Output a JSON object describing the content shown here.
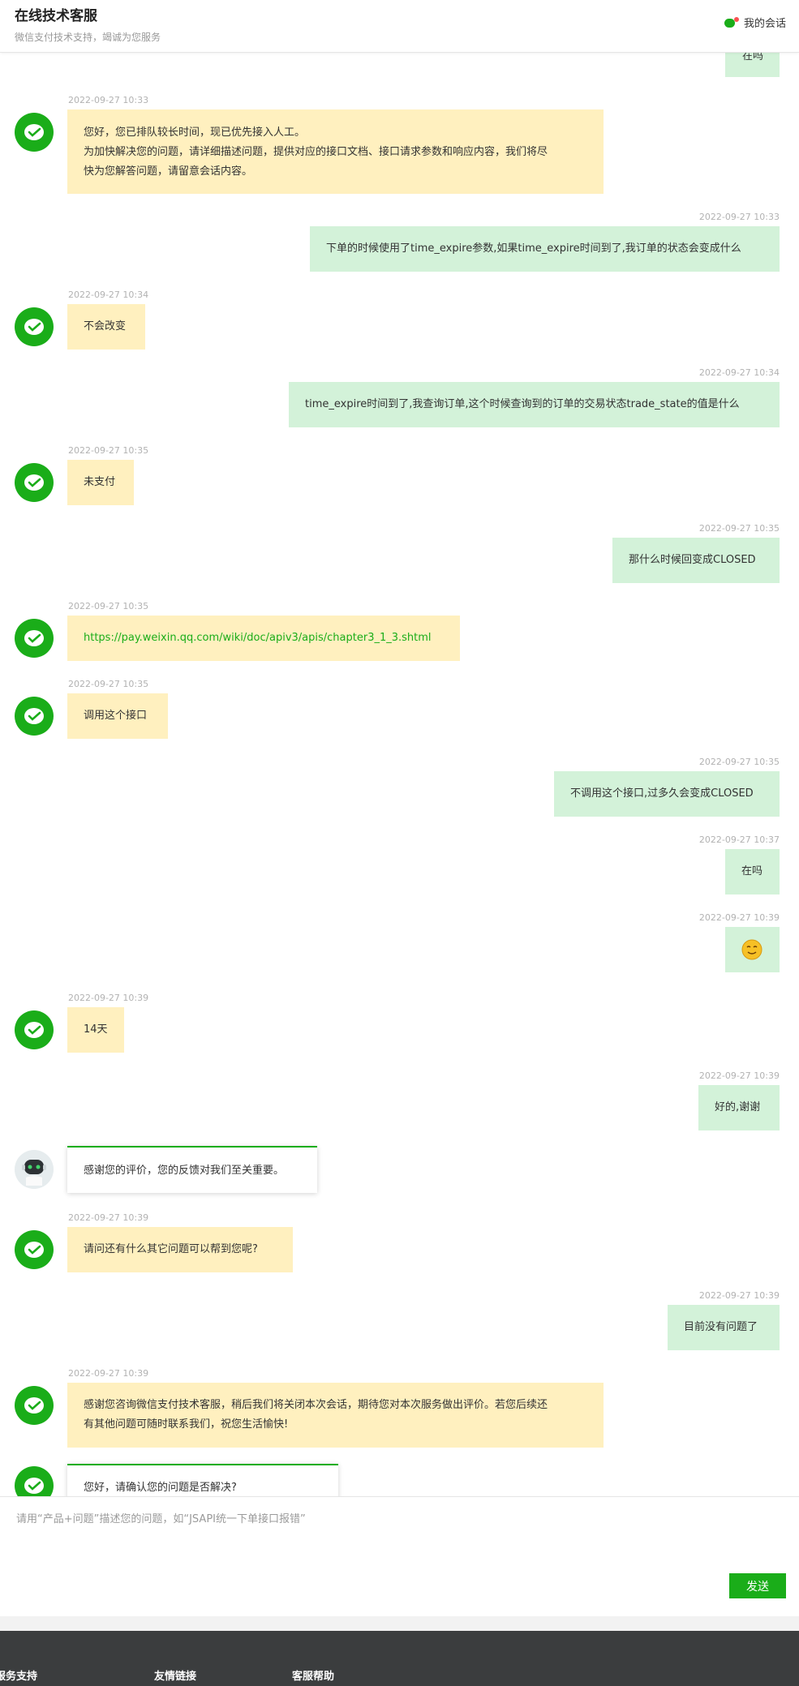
{
  "header": {
    "title": "在线技术客服",
    "subtitle": "微信支付技术支持，竭诚为您服务",
    "my_session": "我的会话"
  },
  "messages": [
    {
      "side": "right",
      "text": "在吗",
      "partial": true
    },
    {
      "side": "left",
      "time": "2022-09-27 10:33",
      "lines": [
        "您好，您已排队较长时间，现已优先接入人工。",
        "为加快解决您的问题，请详细描述问题，提供对应的接口文档、接口请求参数和响应内容，我们将尽",
        "快为您解答问题，请留意会话内容。"
      ]
    },
    {
      "side": "right",
      "time": "2022-09-27 10:33",
      "text": "下单的时候使用了time_expire参数,如果time_expire时间到了,我订单的状态会变成什么"
    },
    {
      "side": "left",
      "time": "2022-09-27 10:34",
      "text": "不会改变"
    },
    {
      "side": "right",
      "time": "2022-09-27 10:34",
      "text": "time_expire时间到了,我查询订单,这个时候查询到的订单的交易状态trade_state的值是什么"
    },
    {
      "side": "left",
      "time": "2022-09-27 10:35",
      "text": "未支付"
    },
    {
      "side": "right",
      "time": "2022-09-27 10:35",
      "text": "那什么时候回变成CLOSED"
    },
    {
      "side": "left",
      "time": "2022-09-27 10:35",
      "text": "https://pay.weixin.qq.com/wiki/doc/apiv3/apis/chapter3_1_3.shtml"
    },
    {
      "side": "left",
      "time": "2022-09-27 10:35",
      "text": "调用这个接口"
    },
    {
      "side": "right",
      "time": "2022-09-27 10:35",
      "text": "不调用这个接口,过多久会变成CLOSED"
    },
    {
      "side": "right",
      "time": "2022-09-27 10:37",
      "text": "在吗"
    },
    {
      "side": "right",
      "time": "2022-09-27 10:39",
      "emoji": "smile-emoji"
    },
    {
      "side": "left",
      "time": "2022-09-27 10:39",
      "text": "14天"
    },
    {
      "side": "right",
      "time": "2022-09-27 10:39",
      "text": "好的,谢谢"
    },
    {
      "side": "left",
      "card": true,
      "text": "感谢您的评价，您的反馈对我们至关重要。"
    },
    {
      "side": "left",
      "time": "2022-09-27 10:39",
      "text": "请问还有什么其它问题可以帮到您呢?"
    },
    {
      "side": "right",
      "time": "2022-09-27 10:39",
      "text": "目前没有问题了"
    },
    {
      "side": "left",
      "time": "2022-09-27 10:39",
      "lines": [
        "感谢您咨询微信支付技术客服，稍后我们将关闭本次会话，期待您对本次服务做出评价。若您后续还",
        "有其他问题可随时联系我们，祝您生活愉快!"
      ]
    },
    {
      "side": "left",
      "card": true,
      "text": "您好，请确认您的问题是否解决?"
    }
  ],
  "composer": {
    "placeholder": "请用“产品+问题”描述您的问题，如“JSAPI统一下单接口报错”",
    "send_label": "发送"
  },
  "footer": {
    "col1": "服务支持",
    "col2": "友情链接",
    "col3": "客服帮助"
  },
  "colors": {
    "brand_green": "#1aad19",
    "agent_bubble": "#fff0bf",
    "user_bubble": "#d3f2d9"
  }
}
